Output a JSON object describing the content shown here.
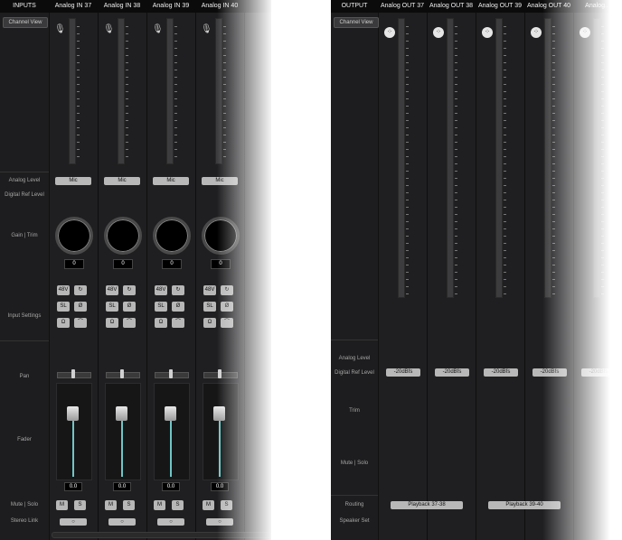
{
  "inputs": {
    "section_label": "INPUTS",
    "channel_view_label": "Channel View",
    "channels": [
      {
        "name": "Analog IN 37",
        "analog_level": "Mic",
        "gain": "0",
        "fader_value": "0.0"
      },
      {
        "name": "Analog IN 38",
        "analog_level": "Mic",
        "gain": "0",
        "fader_value": "0.0"
      },
      {
        "name": "Analog IN 39",
        "analog_level": "Mic",
        "gain": "0",
        "fader_value": "0.0"
      },
      {
        "name": "Analog IN 40",
        "analog_level": "Mic",
        "gain": "0",
        "fader_value": "0.0"
      }
    ],
    "row_labels": {
      "analog_level": "Analog Level",
      "digital_ref_level": "Digital Ref Level",
      "gain_trim": "Gain | Trim",
      "input_settings": "Input Settings",
      "pan": "Pan",
      "fader": "Fader",
      "mute_solo": "Mute | Solo",
      "stereo_link": "Stereo Link"
    },
    "buttons": {
      "phantom": "48V",
      "softlimit": "SL",
      "loop_icon": "↻",
      "phase": "Ø",
      "impedance": "Ω",
      "hpf_icon": "⌒",
      "mute": "M",
      "solo": "S",
      "link": "○"
    },
    "fader_scale": [
      "6",
      "0",
      "-5",
      "-10",
      "-20",
      "-30",
      "-40"
    ]
  },
  "output": {
    "section_label": "OUTPUT",
    "channel_view_label": "Channel View",
    "channels": [
      {
        "name": "Analog OUT 37",
        "ref_level": "-20dBfs"
      },
      {
        "name": "Analog OUT 38",
        "ref_level": "-20dBfs"
      },
      {
        "name": "Analog OUT 39",
        "ref_level": "-20dBfs"
      },
      {
        "name": "Analog OUT 40",
        "ref_level": "-20dBfs"
      },
      {
        "name": "Analog...",
        "ref_level": "-20dBfs"
      }
    ],
    "routing": [
      "Playback 37-38",
      "Playback 39-40"
    ],
    "row_labels": {
      "analog_level": "Analog Level",
      "digital_ref_level": "Digital Ref Level",
      "trim": "Trim",
      "mute_solo": "Mute | Solo",
      "routing": "Routing",
      "speaker_set": "Speaker Set"
    },
    "xlr_icon": "xlr-icon"
  }
}
